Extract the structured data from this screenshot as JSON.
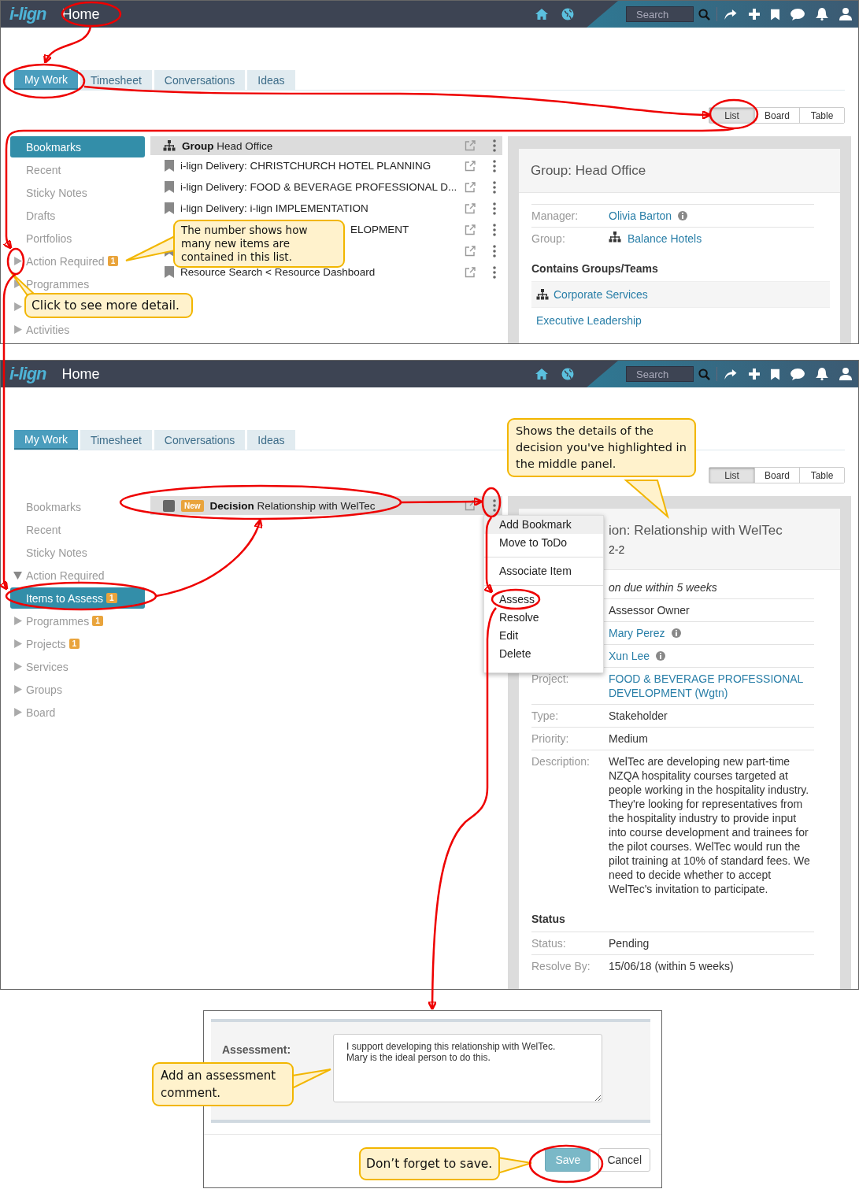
{
  "screen_1": {
    "header": {
      "logo": "i-lign",
      "title": "Home",
      "search_placeholder": "Search"
    },
    "tabs": [
      {
        "label": "My Work",
        "selected": true
      },
      {
        "label": "Timesheet",
        "selected": false
      },
      {
        "label": "Conversations",
        "selected": false
      },
      {
        "label": "Ideas",
        "selected": false
      }
    ],
    "view_switch": [
      {
        "label": "List",
        "selected": true
      },
      {
        "label": "Board",
        "selected": false
      },
      {
        "label": "Table",
        "selected": false
      }
    ],
    "sidebar": [
      {
        "kind": "link",
        "label": "Bookmarks",
        "selected": true
      },
      {
        "kind": "link",
        "label": "Recent",
        "selected": false
      },
      {
        "kind": "link",
        "label": "Sticky Notes",
        "selected": false
      },
      {
        "kind": "link",
        "label": "Drafts",
        "selected": false
      },
      {
        "kind": "link",
        "label": "Portfolios",
        "selected": false
      },
      {
        "kind": "group",
        "label": "Action Required",
        "badge": "1",
        "selected": false,
        "expanded": false
      },
      {
        "kind": "group",
        "label": "Programmes",
        "selected": false,
        "expanded": false
      },
      {
        "kind": "group",
        "selected": false,
        "expanded": false
      },
      {
        "kind": "group",
        "label": "Activities",
        "selected": false,
        "expanded": false
      }
    ],
    "list": {
      "header": {
        "type": "Group",
        "title": "Head Office"
      },
      "rows": [
        {
          "kind": "full",
          "title": "i-lign Delivery: CHRISTCHURCH HOTEL PLANNING"
        },
        {
          "kind": "full",
          "title": "i-lign Delivery: FOOD & BEVERAGE PROFESSIONAL D..."
        },
        {
          "kind": "full",
          "title": "i-lign Delivery: i-lign IMPLEMENTATION"
        },
        {
          "kind": "partial",
          "title": "ELOPMENT"
        },
        {
          "kind": "hidden"
        },
        {
          "kind": "full",
          "title": "Resource Search < Resource Dashboard"
        }
      ]
    },
    "detail": {
      "title": "Group: Head Office",
      "fields": [
        {
          "label": "Manager:",
          "value": "Olivia Barton",
          "kind": "person"
        },
        {
          "label": "Group:",
          "value": "Balance Hotels",
          "kind": "group"
        }
      ],
      "section": "Contains Groups/Teams",
      "items": [
        {
          "label": "Corporate Services",
          "kind": "group"
        },
        {
          "label": "Executive Leadership",
          "kind": "plain"
        }
      ]
    },
    "callouts": [
      "The number shows how many new items are contained in this list.",
      "Click to see more detail."
    ]
  },
  "screen_2": {
    "header": {
      "logo": "i-lign",
      "title": "Home",
      "search_placeholder": "Search"
    },
    "tabs": [
      {
        "label": "My Work",
        "selected": true
      },
      {
        "label": "Timesheet",
        "selected": false
      },
      {
        "label": "Conversations",
        "selected": false
      },
      {
        "label": "Ideas",
        "selected": false
      }
    ],
    "view_switch": [
      {
        "label": "List",
        "selected": true
      },
      {
        "label": "Board",
        "selected": false
      },
      {
        "label": "Table",
        "selected": false
      }
    ],
    "sidebar": [
      {
        "kind": "link",
        "label": "Bookmarks",
        "selected": false
      },
      {
        "kind": "link",
        "label": "Recent",
        "selected": false
      },
      {
        "kind": "link",
        "label": "Sticky Notes",
        "selected": false
      },
      {
        "kind": "group",
        "label": "Action Required",
        "selected": false,
        "expanded": true,
        "children": [
          {
            "kind": "link",
            "label": "Items to Assess",
            "badge": "1",
            "selected": true
          }
        ]
      },
      {
        "kind": "group",
        "label": "Programmes",
        "badge": "1",
        "selected": false,
        "expanded": false
      },
      {
        "kind": "group",
        "label": "Projects",
        "badge": "1",
        "selected": false,
        "expanded": false
      },
      {
        "kind": "group",
        "label": "Services",
        "selected": false,
        "expanded": false
      },
      {
        "kind": "group",
        "label": "Groups",
        "selected": false,
        "expanded": false
      },
      {
        "kind": "group",
        "label": "Board",
        "selected": false,
        "expanded": false
      }
    ],
    "list": {
      "header": {
        "type": "Decision",
        "title": "Relationship with WelTec",
        "badge": "New"
      }
    },
    "menu": [
      {
        "items": [
          {
            "label": "Add Bookmark",
            "highlighted": true
          },
          {
            "label": "Move to ToDo",
            "highlighted": false
          }
        ]
      },
      {
        "items": [
          {
            "label": "Associate Item",
            "highlighted": false
          }
        ]
      },
      {
        "items": [
          {
            "label": "Assess",
            "highlighted": false
          },
          {
            "label": "Resolve",
            "highlighted": false
          },
          {
            "label": "Edit",
            "highlighted": false
          },
          {
            "label": "Delete",
            "highlighted": false
          }
        ]
      }
    ],
    "detail": {
      "title": "ion: Relationship with WelTec",
      "subtitle": "2-2",
      "note": "on due within 5 weeks",
      "fields": [
        {
          "value": "Assessor Owner",
          "kind": "text"
        },
        {
          "value": "Mary Perez",
          "kind": "person"
        },
        {
          "value": "Xun Lee",
          "kind": "person"
        },
        {
          "label": "Project:",
          "value": "FOOD & BEVERAGE PROFESSIONAL DEVELOPMENT (Wgtn)",
          "kind": "link"
        },
        {
          "label": "Type:",
          "value": "Stakeholder",
          "kind": "text"
        },
        {
          "label": "Priority:",
          "value": "Medium",
          "kind": "text"
        },
        {
          "label": "Description:",
          "value": "WelTec are developing new part-time NZQA hospitality courses targeted at people working in the hospitality industry. They're looking for representatives from the hospitality industry to provide input into course development and trainees for the pilot courses. WelTec would run the pilot training at 10% of standard fees. We need to decide whether to accept WelTec's invitation to participate.",
          "kind": "text"
        }
      ],
      "section": "Status",
      "section_fields": [
        {
          "label": "Status:",
          "value": "Pending",
          "kind": "text"
        },
        {
          "label": "Resolve By:",
          "value": "15/06/18 (within 5 weeks)",
          "kind": "text"
        }
      ]
    },
    "callouts": [
      "Shows the details of the decision you've highlighted in the middle panel."
    ]
  },
  "assessment_dialog": {
    "label": "Assessment:",
    "value": "I support developing this relationship with WelTec. Mary is the ideal person to do this.",
    "buttons": [
      {
        "label": "Save",
        "kind": "primary"
      },
      {
        "label": "Cancel",
        "kind": "secondary"
      }
    ],
    "callouts": [
      "Add an assessment comment.",
      "Don’t forget to save."
    ]
  }
}
